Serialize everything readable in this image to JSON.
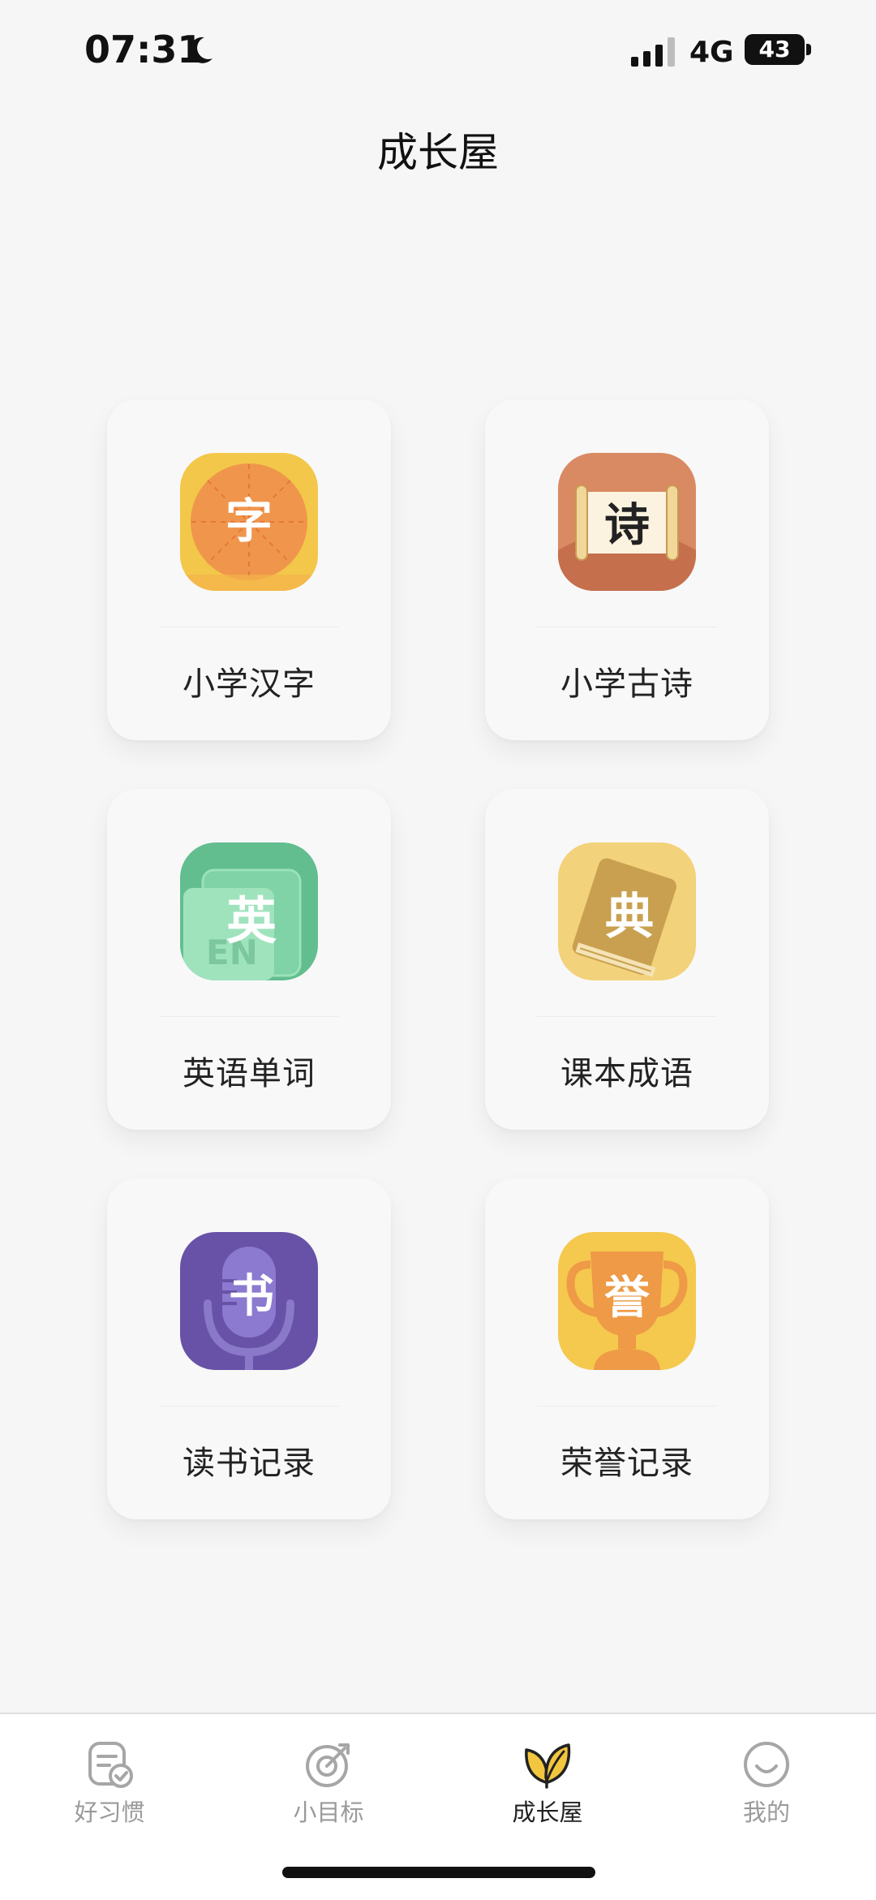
{
  "status_bar": {
    "time": "07:31",
    "network": "4G",
    "battery": "43"
  },
  "header": {
    "title": "成长屋"
  },
  "cards": [
    {
      "label": "小学汉字",
      "glyph": "字",
      "icon": "hanzi-icon"
    },
    {
      "label": "小学古诗",
      "glyph": "诗",
      "icon": "poem-scroll-icon"
    },
    {
      "label": "英语单词",
      "glyph": "英",
      "icon": "english-book-icon"
    },
    {
      "label": "课本成语",
      "glyph": "典",
      "icon": "dictionary-icon"
    },
    {
      "label": "读书记录",
      "glyph": "书",
      "icon": "microphone-icon"
    },
    {
      "label": "荣誉记录",
      "glyph": "誉",
      "icon": "trophy-icon"
    }
  ],
  "tabs": [
    {
      "label": "好习惯",
      "icon": "checklist-icon",
      "active": false
    },
    {
      "label": "小目标",
      "icon": "target-icon",
      "active": false
    },
    {
      "label": "成长屋",
      "icon": "leaf-icon",
      "active": true
    },
    {
      "label": "我的",
      "icon": "smile-icon",
      "active": false
    }
  ],
  "colors": {
    "hanzi_bg": "#f0a04b",
    "poem_bg": "#c9764f",
    "english_bg": "#5fb98a",
    "dictionary_bg": "#f0cc6e",
    "reading_bg": "#6c55a8",
    "honor_bg": "#f5c44f"
  }
}
